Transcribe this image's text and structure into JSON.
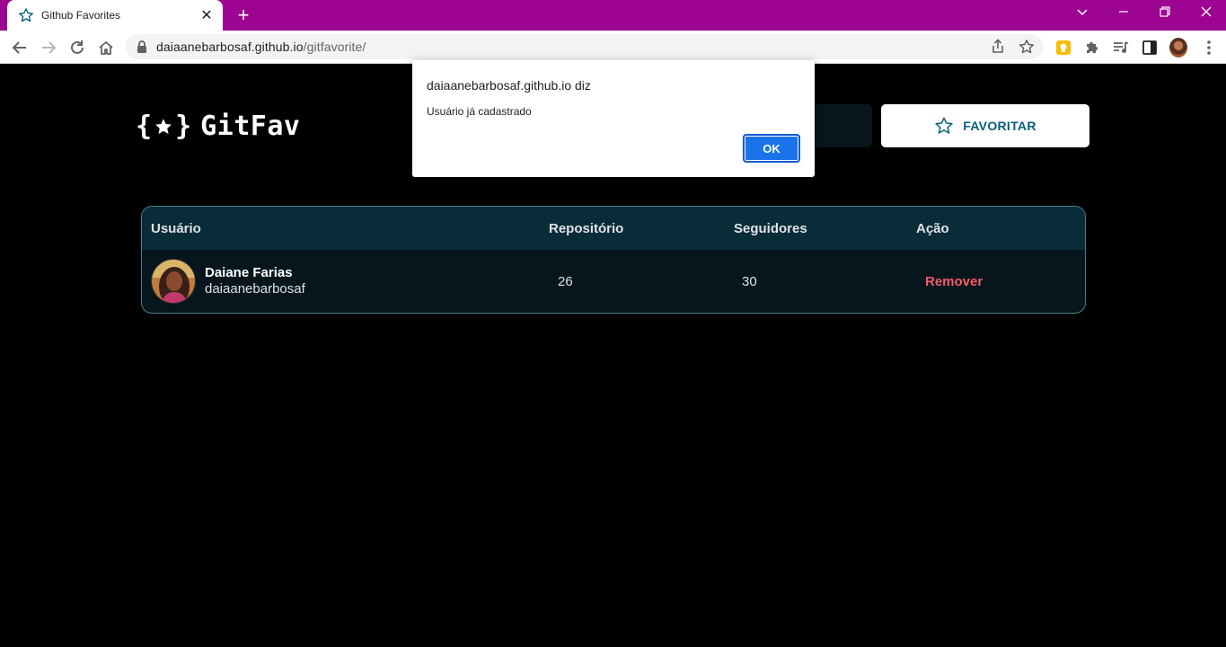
{
  "browser": {
    "tab_title": "Github Favorites",
    "new_tab": "+",
    "url_domain": "daiaanebarbosaf.github.io",
    "url_path": "/gitfavorite/"
  },
  "app": {
    "logo_open": "{",
    "logo_close": "}",
    "logo_name": "GitFav",
    "favorite_button": "FAVORITAR",
    "table": {
      "headers": [
        "Usuário",
        "Repositório",
        "Seguidores",
        "Ação"
      ],
      "rows": [
        {
          "name": "Daiane Farias",
          "login": "daiaanebarbosaf",
          "repos": "26",
          "followers": "30",
          "action": "Remover"
        }
      ]
    }
  },
  "dialog": {
    "title": "daiaanebarbosaf.github.io diz",
    "message": "Usuário já cadastrado",
    "ok": "OK"
  },
  "colors": {
    "titlebar": "#9c0491",
    "accent": "#065e7c",
    "remove": "#f75a68",
    "header_bg": "#092d38",
    "row_bg": "#06161c"
  }
}
